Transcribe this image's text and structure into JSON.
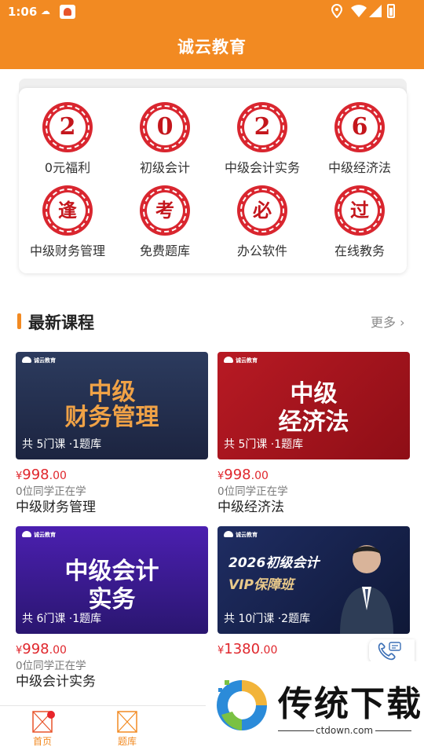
{
  "status_bar": {
    "time": "1:06"
  },
  "header": {
    "title": "诚云教育"
  },
  "grid": {
    "items": [
      {
        "glyph": "2",
        "label": "0元福利"
      },
      {
        "glyph": "0",
        "label": "初级会计"
      },
      {
        "glyph": "2",
        "label": "中级会计实务"
      },
      {
        "glyph": "6",
        "label": "中级经济法"
      },
      {
        "glyph": "逢",
        "label": "中级财务管理"
      },
      {
        "glyph": "考",
        "label": "免费题库"
      },
      {
        "glyph": "必",
        "label": "办公软件"
      },
      {
        "glyph": "过",
        "label": "在线教务"
      }
    ]
  },
  "section": {
    "title": "最新课程",
    "more": "更多 ›"
  },
  "courses": [
    {
      "logo": "诚云教育",
      "thumb_line1": "中级",
      "thumb_line2": "财务管理",
      "meta": "共 5门课 ·1题库",
      "yen": "¥",
      "price": "998",
      "cents": ".00",
      "learners": "0位同学正在学",
      "name": "中级财务管理"
    },
    {
      "logo": "诚云教育",
      "thumb_line1": "中级",
      "thumb_line2": "经济法",
      "meta": "共 5门课 ·1题库",
      "yen": "¥",
      "price": "998",
      "cents": ".00",
      "learners": "0位同学正在学",
      "name": "中级经济法"
    },
    {
      "logo": "诚云教育",
      "thumb_line1": "中级会计",
      "thumb_line2": "实务",
      "meta": "共 6门课 ·1题库",
      "yen": "¥",
      "price": "998",
      "cents": ".00",
      "learners": "0位同学正在学",
      "name": "中级会计实务"
    },
    {
      "logo": "诚云教育",
      "thumb_line1": "2026初级会计",
      "thumb_line2": "VIP保障班",
      "meta": "共 10门课 ·2题库",
      "yen": "¥",
      "price": "1380",
      "cents": ".00",
      "learners": "",
      "name": ""
    }
  ],
  "bottom_nav": [
    {
      "label": "首页",
      "icon": "home-icon"
    },
    {
      "label": "题库",
      "icon": "question-bank-icon"
    }
  ],
  "watermark": {
    "text": "传统下载",
    "url": "ctdown.com"
  },
  "colors": {
    "brand": "#f28a22",
    "price": "#e0262c",
    "medal": "#d9262f"
  }
}
